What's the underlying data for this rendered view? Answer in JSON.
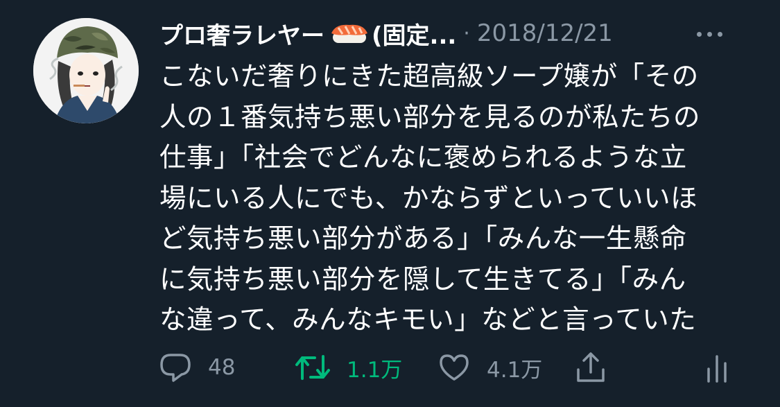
{
  "tweet": {
    "display_name": "プロ奢ラレヤー",
    "display_name_suffix": "(固定...",
    "separator": "·",
    "date": "2018/12/21",
    "text": "こないだ奢りにきた超高級ソープ嬢が「その\n人の１番気持ち悪い部分を見るのが私たちの\n仕事」「社会でどんなに褒められるような立\n場にいる人にでも、かならずといっていいほ\nど気持ち悪い部分がある」「みんな一生懸命\nに気持ち悪い部分を隠して生きてる」「みん\nな違って、みんなキモい」などと言っていた"
  },
  "actions": {
    "reply_count": "48",
    "retweet_count": "1.1万",
    "like_count": "4.1万"
  },
  "colors": {
    "background": "#15202b",
    "text": "#ffffff",
    "muted": "#8b98a5",
    "retweet_active": "#00ba7c"
  },
  "icons": {
    "avatar": "profile-avatar",
    "sushi": "sushi-emoji-icon",
    "more": "more-options-icon",
    "reply": "reply-icon",
    "retweet": "retweet-icon",
    "like": "heart-icon",
    "share": "share-icon",
    "analytics": "analytics-icon"
  }
}
